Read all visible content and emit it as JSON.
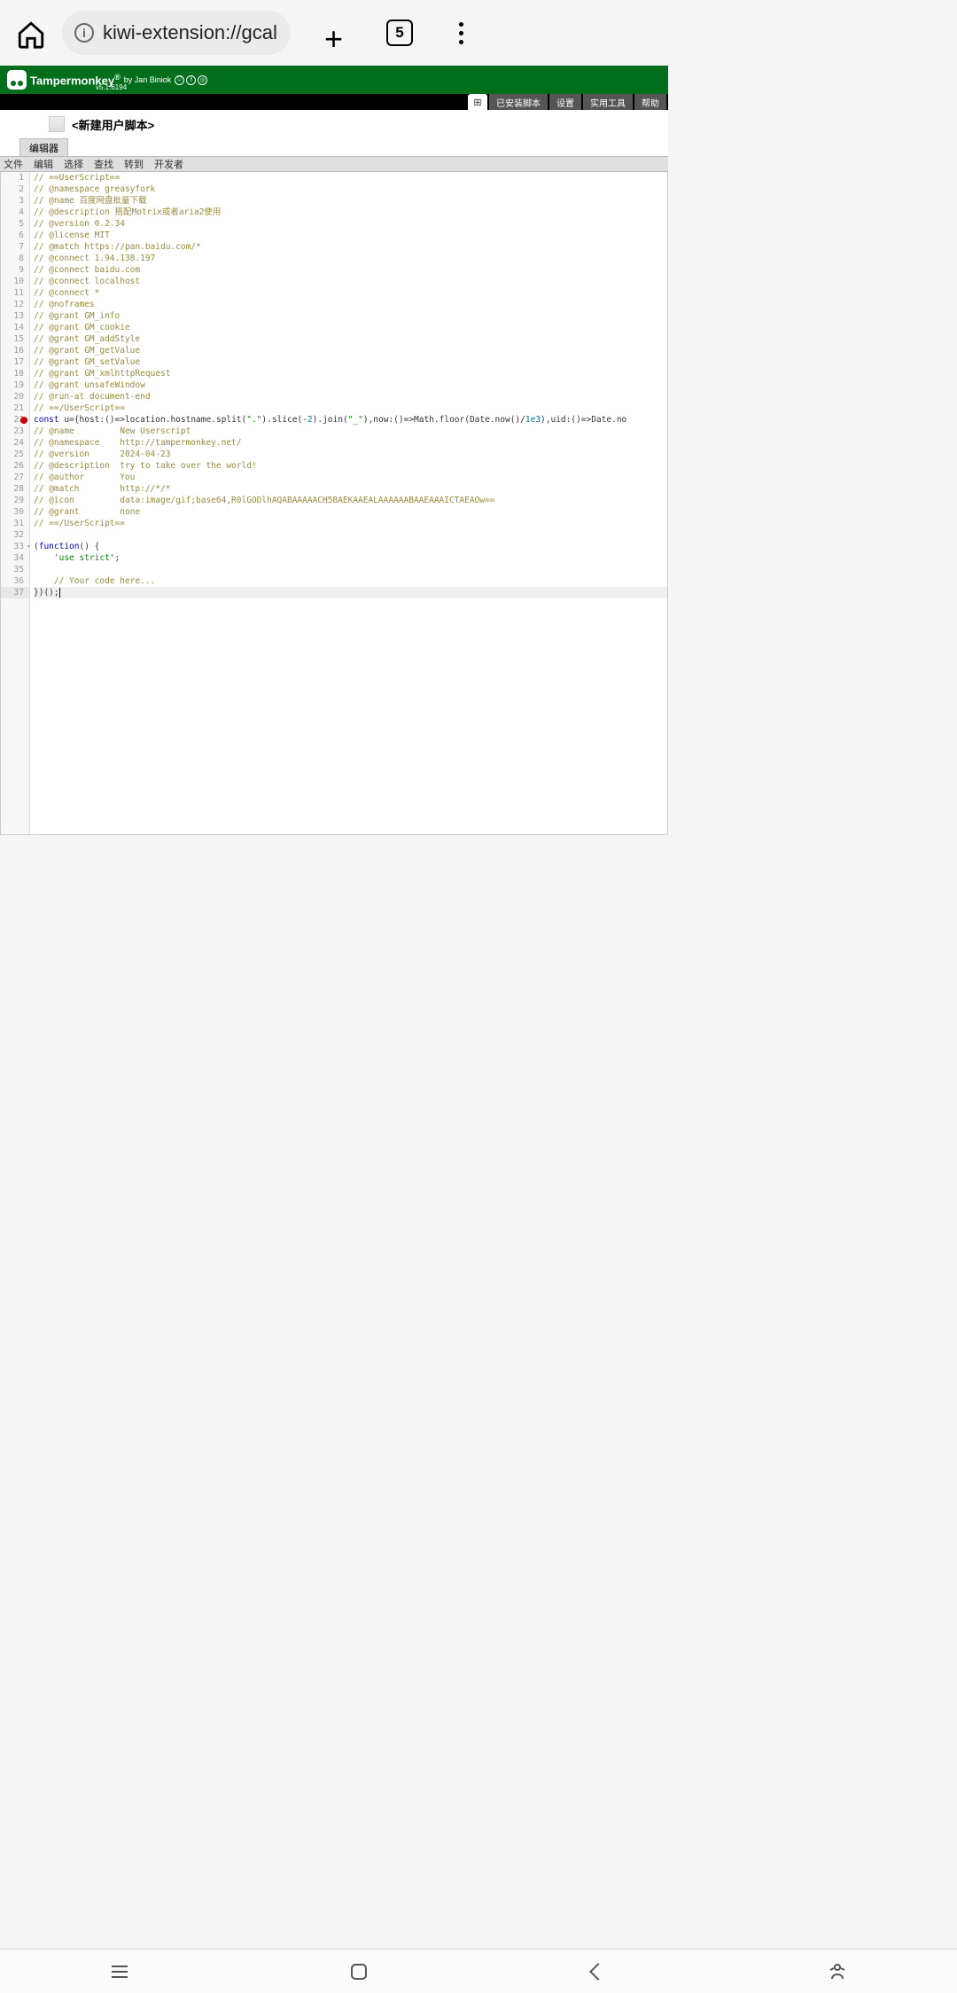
{
  "browser": {
    "url": "kiwi-extension://gcale",
    "tab_count": "5"
  },
  "header": {
    "title": "Tampermonkey",
    "reg": "®",
    "by": "by Jan Biniok",
    "version": "v5.1.6194"
  },
  "top_tabs": {
    "add": "⊞",
    "installed": "已安装脚本",
    "settings": "设置",
    "utils": "实用工具",
    "help": "帮助"
  },
  "script": {
    "title": "<新建用户脚本>"
  },
  "editor_tab": "编辑器",
  "menu": {
    "file": "文件",
    "edit": "编辑",
    "select": "选择",
    "find": "查找",
    "goto": "转到",
    "dev": "开发者"
  },
  "code": [
    {
      "n": 1,
      "seg": [
        [
          "c",
          "// ==UserScript=="
        ]
      ]
    },
    {
      "n": 2,
      "seg": [
        [
          "c",
          "// @namespace greasyfork"
        ]
      ]
    },
    {
      "n": 3,
      "seg": [
        [
          "c",
          "// @name 百度网盘批量下载"
        ]
      ]
    },
    {
      "n": 4,
      "seg": [
        [
          "c",
          "// @description 搭配Motrix或者aria2使用"
        ]
      ]
    },
    {
      "n": 5,
      "seg": [
        [
          "c",
          "// @version 0.2.34"
        ]
      ]
    },
    {
      "n": 6,
      "seg": [
        [
          "c",
          "// @license MIT"
        ]
      ]
    },
    {
      "n": 7,
      "seg": [
        [
          "c",
          "// @match https://pan.baidu.com/*"
        ]
      ]
    },
    {
      "n": 8,
      "seg": [
        [
          "c",
          "// @connect 1.94.138.197"
        ]
      ]
    },
    {
      "n": 9,
      "seg": [
        [
          "c",
          "// @connect baidu.com"
        ]
      ]
    },
    {
      "n": 10,
      "seg": [
        [
          "c",
          "// @connect localhost"
        ]
      ]
    },
    {
      "n": 11,
      "seg": [
        [
          "c",
          "// @connect *"
        ]
      ]
    },
    {
      "n": 12,
      "seg": [
        [
          "c",
          "// @noframes"
        ]
      ]
    },
    {
      "n": 13,
      "seg": [
        [
          "c",
          "// @grant GM_info"
        ]
      ]
    },
    {
      "n": 14,
      "seg": [
        [
          "c",
          "// @grant GM_cookie"
        ]
      ]
    },
    {
      "n": 15,
      "seg": [
        [
          "c",
          "// @grant GM_addStyle"
        ]
      ]
    },
    {
      "n": 16,
      "seg": [
        [
          "c",
          "// @grant GM_getValue"
        ]
      ]
    },
    {
      "n": 17,
      "seg": [
        [
          "c",
          "// @grant GM_setValue"
        ]
      ]
    },
    {
      "n": 18,
      "seg": [
        [
          "c",
          "// @grant GM_xmlhttpRequest"
        ]
      ]
    },
    {
      "n": 19,
      "seg": [
        [
          "c",
          "// @grant unsafeWindow"
        ]
      ]
    },
    {
      "n": 20,
      "seg": [
        [
          "c",
          "// @run-at document-end"
        ]
      ]
    },
    {
      "n": 21,
      "seg": [
        [
          "c",
          "// ==/UserScript=="
        ]
      ]
    },
    {
      "n": 22,
      "err": true,
      "seg": [
        [
          "k",
          "const"
        ],
        [
          "p",
          " u={host:()=>location.hostname.split("
        ],
        [
          "s",
          "\".\""
        ],
        [
          "p",
          ").slice(-"
        ],
        [
          "n",
          "2"
        ],
        [
          "p",
          ").join("
        ],
        [
          "s",
          "\"_\""
        ],
        [
          "p",
          "),now:()=>Math.floor(Date.now()/"
        ],
        [
          "n",
          "1e3"
        ],
        [
          "p",
          "),uid:()=>Date.no"
        ]
      ]
    },
    {
      "n": 23,
      "seg": [
        [
          "c",
          "// @name         New Userscript"
        ]
      ]
    },
    {
      "n": 24,
      "seg": [
        [
          "c",
          "// @namespace    http://tampermonkey.net/"
        ]
      ]
    },
    {
      "n": 25,
      "seg": [
        [
          "c",
          "// @version      2024-04-23"
        ]
      ]
    },
    {
      "n": 26,
      "seg": [
        [
          "c",
          "// @description  try to take over the world!"
        ]
      ]
    },
    {
      "n": 27,
      "seg": [
        [
          "c",
          "// @author       You"
        ]
      ]
    },
    {
      "n": 28,
      "seg": [
        [
          "c",
          "// @match        http://*/*"
        ]
      ]
    },
    {
      "n": 29,
      "seg": [
        [
          "c",
          "// @icon         data:image/gif;base64,R0lGODlhAQABAAAAACH5BAEKAAEALAAAAAABAAEAAAICTAEAOw=="
        ]
      ]
    },
    {
      "n": 30,
      "seg": [
        [
          "c",
          "// @grant        none"
        ]
      ]
    },
    {
      "n": 31,
      "seg": [
        [
          "c",
          "// ==/UserScript=="
        ]
      ]
    },
    {
      "n": 32,
      "seg": [
        [
          "p",
          ""
        ]
      ]
    },
    {
      "n": 33,
      "fold": true,
      "seg": [
        [
          "p",
          "("
        ],
        [
          "k",
          "function"
        ],
        [
          "p",
          "() {"
        ]
      ]
    },
    {
      "n": 34,
      "seg": [
        [
          "p",
          "    "
        ],
        [
          "s",
          "'use strict'"
        ],
        [
          "p",
          ";"
        ]
      ]
    },
    {
      "n": 35,
      "seg": [
        [
          "p",
          ""
        ]
      ]
    },
    {
      "n": 36,
      "seg": [
        [
          "p",
          "    "
        ],
        [
          "c",
          "// Your code here..."
        ]
      ]
    },
    {
      "n": 37,
      "hl": true,
      "cursor": true,
      "seg": [
        [
          "p",
          "})();"
        ]
      ]
    }
  ]
}
